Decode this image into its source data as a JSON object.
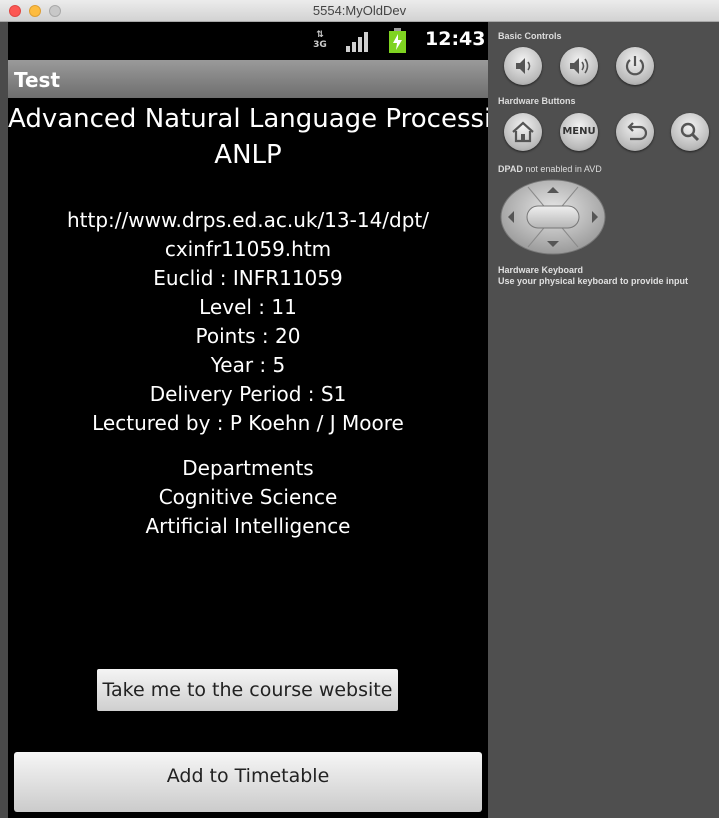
{
  "window": {
    "title": "5554:MyOldDev"
  },
  "statusbar": {
    "network": "3G",
    "time": "12:43"
  },
  "app": {
    "title": "Test"
  },
  "course": {
    "name": "Advanced Natural Language Processing",
    "code": "ANLP",
    "url_line1": "http://www.drps.ed.ac.uk/13-14/dpt/",
    "url_line2": "cxinfr11059.htm",
    "euclid": "Euclid : INFR11059",
    "level": "Level : 11",
    "points": "Points : 20",
    "year": "Year : 5",
    "delivery": "Delivery Period : S1",
    "lecturers": "Lectured by : P Koehn / J Moore",
    "departments_heading": "Departments",
    "departments": [
      "Cognitive Science",
      "Artificial Intelligence"
    ]
  },
  "buttons": {
    "website": "Take me to the course website",
    "timetable": "Add to Timetable"
  },
  "controls": {
    "basic_label": "Basic Controls",
    "hardware_label": "Hardware Buttons",
    "menu_label": "MENU",
    "dpad_label": "DPAD",
    "dpad_note": "not enabled in AVD",
    "keyboard_label": "Hardware Keyboard",
    "keyboard_note": "Use your physical keyboard to provide input"
  }
}
